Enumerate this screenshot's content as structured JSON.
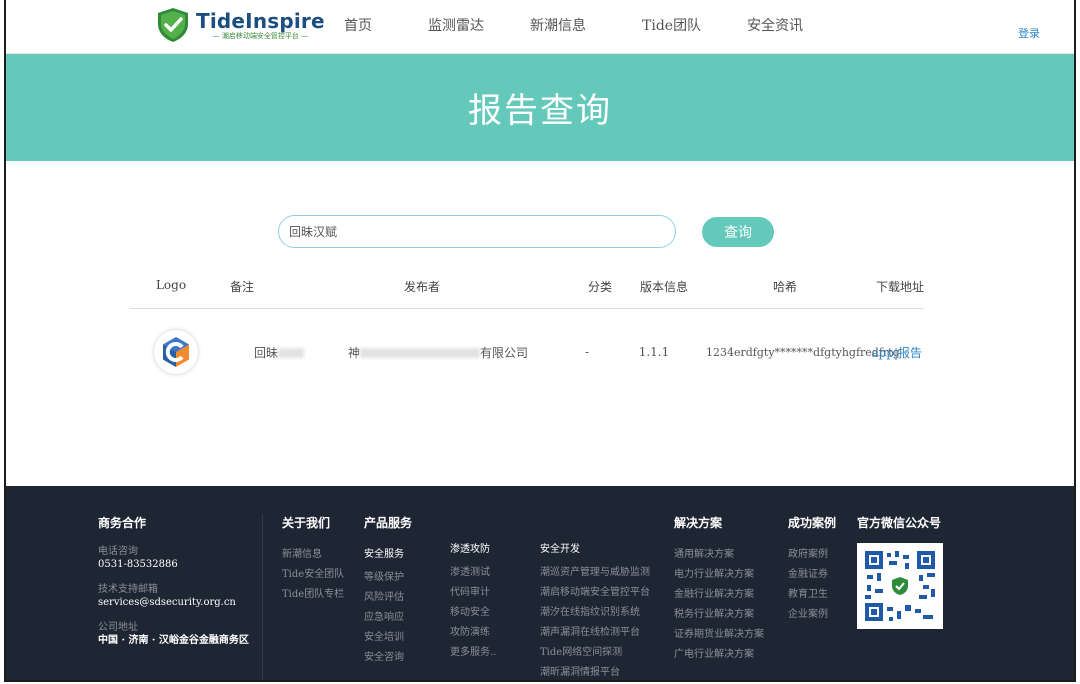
{
  "header": {
    "logo_name": "TideInspire",
    "logo_subtitle": "— 潮启移动端安全管控平台 —",
    "nav": [
      "首页",
      "监测雷达",
      "新潮信息",
      "Tide团队",
      "安全资讯"
    ],
    "login": "登录"
  },
  "banner": {
    "title": "报告查询"
  },
  "search": {
    "value": "回昧汉赋",
    "button": "查询"
  },
  "table": {
    "headers": [
      "Logo",
      "备注",
      "发布者",
      "分类",
      "版本信息",
      "哈希",
      "下载地址"
    ],
    "rows": [
      {
        "note_prefix": "回昧",
        "publisher_prefix": "神",
        "publisher_suffix": "有限公司",
        "category": "-",
        "version": "1.1.1",
        "hash": "1234erdfgty*******dfgtyhgfredfrtg",
        "link_app": "app",
        "link_sep": "|",
        "link_report": "报告"
      }
    ]
  },
  "footer": {
    "business": {
      "title": "商务合作",
      "phone_label": "电话咨询",
      "phone": "0531-83532886",
      "email_label": "技术支持邮箱",
      "email": "services@sdsecurity.org.cn",
      "address_label": "公司地址",
      "address": "中国 · 济南 · 汉峪金谷金融商务区"
    },
    "about": {
      "title": "关于我们",
      "items": [
        "新潮信息",
        "Tide安全团队",
        "Tide团队专栏"
      ]
    },
    "products": {
      "title": "产品服务",
      "security": {
        "title": "安全服务",
        "items": [
          "等级保护",
          "风险评估",
          "应急响应",
          "安全培训",
          "安全咨询"
        ]
      },
      "pentest": {
        "title": "渗透攻防",
        "items": [
          "渗透测试",
          "代码审计",
          "移动安全",
          "攻防演练",
          "更多服务.."
        ]
      },
      "dev": {
        "title": "安全开发",
        "items": [
          "潮巡资产管理与威胁监测",
          "潮启移动端安全管控平台",
          "潮汐在线指纹识别系统",
          "潮声漏洞在线检测平台",
          "Tide网络空间探测",
          "潮昕漏洞情报平台"
        ]
      }
    },
    "solutions": {
      "title": "解决方案",
      "items": [
        "通用解决方案",
        "电力行业解决方案",
        "金融行业解决方案",
        "税务行业解决方案",
        "证券期货业解决方案",
        "广电行业解决方案"
      ]
    },
    "cases": {
      "title": "成功案例",
      "items": [
        "政府案例",
        "金融证券",
        "教育卫生",
        "企业案例"
      ]
    },
    "wechat": {
      "title": "官方微信公众号"
    }
  }
}
